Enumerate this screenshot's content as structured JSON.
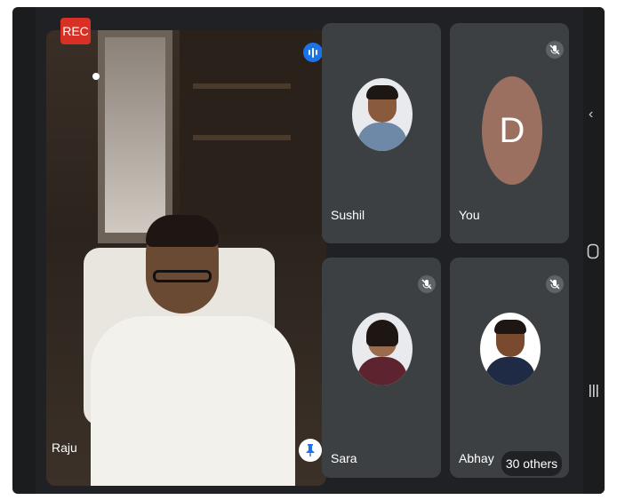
{
  "recording": {
    "label": "REC",
    "color": "#d93025"
  },
  "main_speaker": {
    "name": "Raju",
    "speaking_indicator": "audio-wave-icon",
    "pin_icon": "pin-icon"
  },
  "participants": [
    {
      "name": "Sushil",
      "muted": false
    },
    {
      "name": "You",
      "avatar_letter": "D",
      "avatar_color": "#9b7060",
      "muted": true
    },
    {
      "name": "Sara",
      "muted": true
    },
    {
      "name": "Abhay",
      "muted": true
    }
  ],
  "others_count": "30 others",
  "nav_bar": {
    "back": "back-icon",
    "home": "home-icon",
    "recents": "recents-icon"
  }
}
